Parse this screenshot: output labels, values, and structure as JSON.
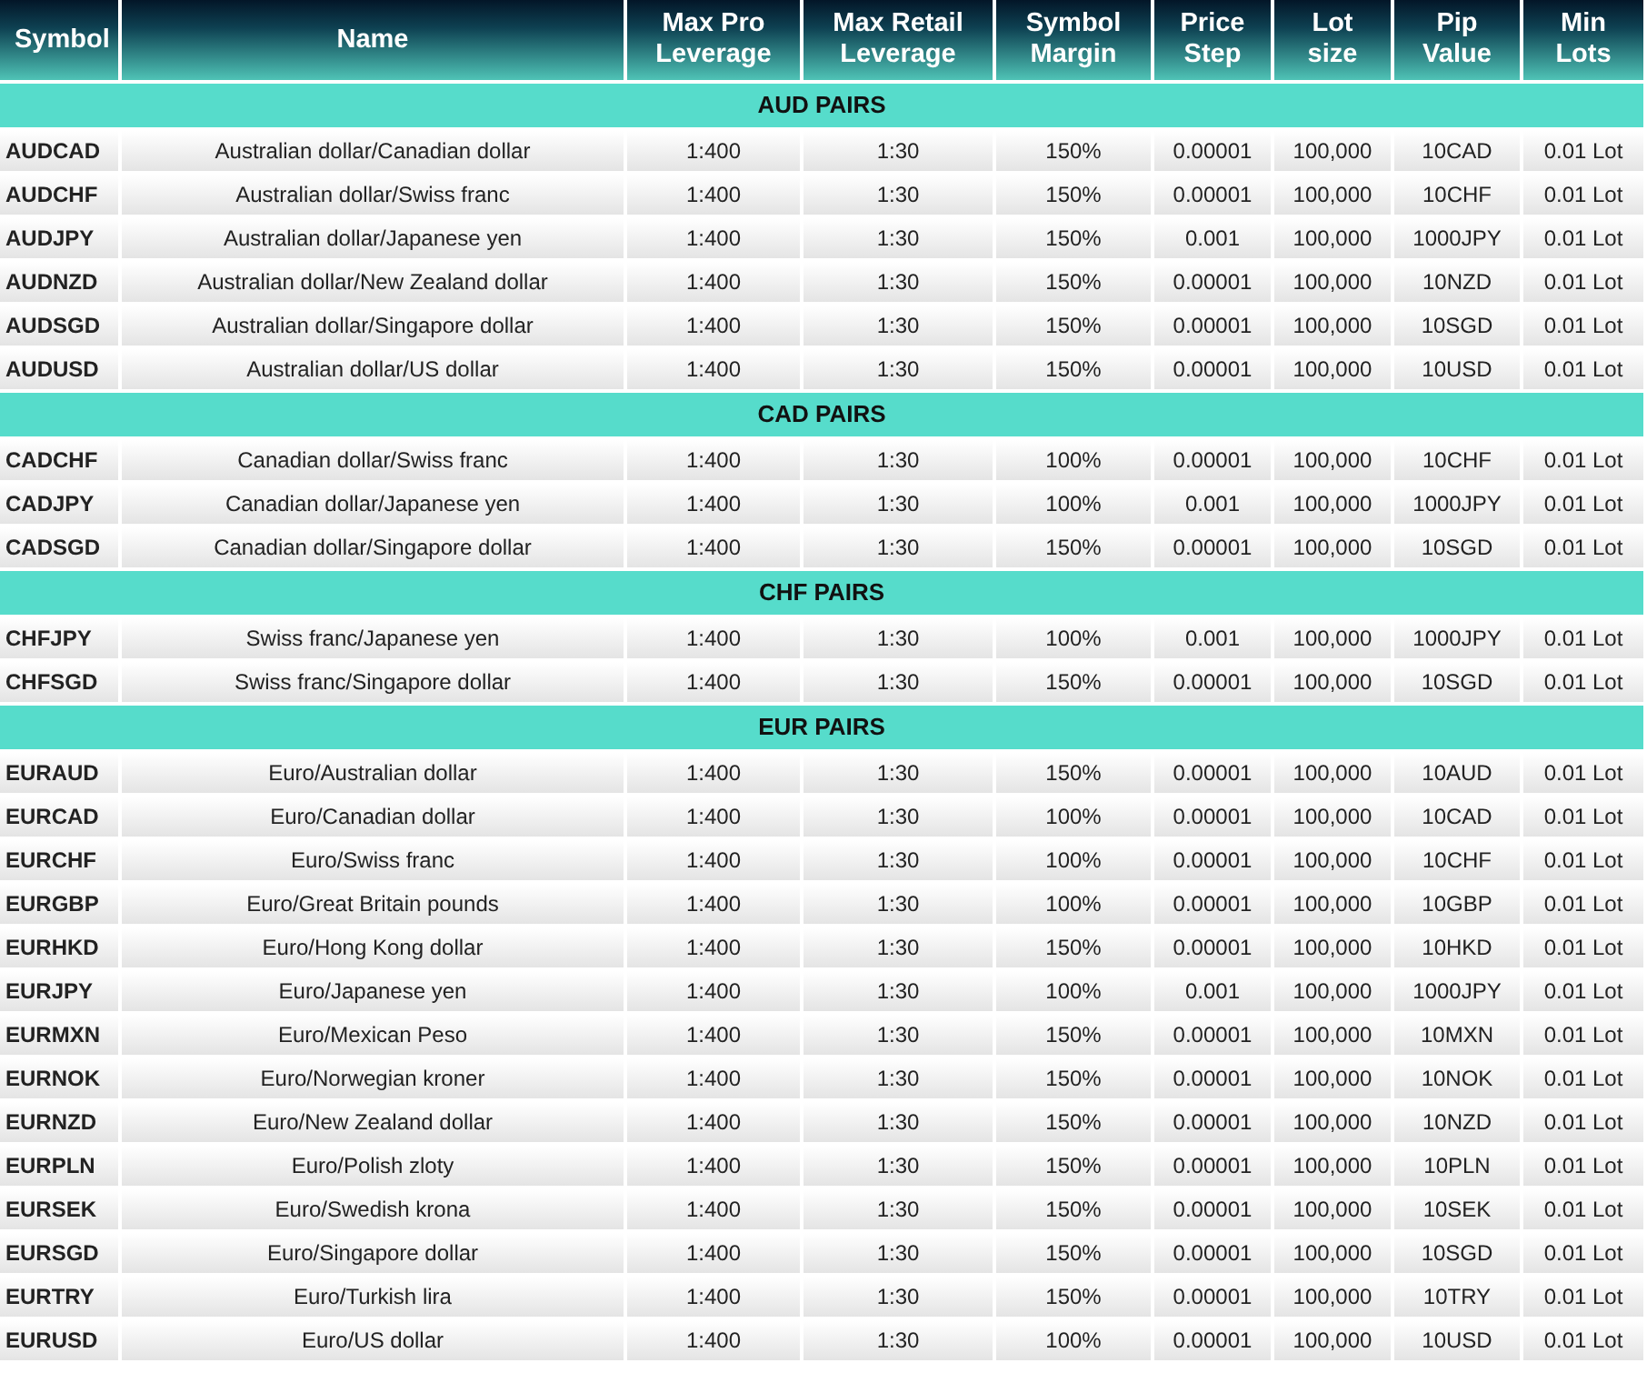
{
  "columns": [
    "Symbol",
    "Name",
    "Max Pro Leverage",
    "Max Retail Leverage",
    "Symbol Margin",
    "Price Step",
    "Lot size",
    "Pip Value",
    "Min Lots"
  ],
  "groups": [
    {
      "title": "AUD PAIRS",
      "rows": [
        [
          "AUDCAD",
          "Australian dollar/Canadian dollar",
          "1:400",
          "1:30",
          "150%",
          "0.00001",
          "100,000",
          "10CAD",
          "0.01 Lot"
        ],
        [
          "AUDCHF",
          "Australian dollar/Swiss franc",
          "1:400",
          "1:30",
          "150%",
          "0.00001",
          "100,000",
          "10CHF",
          "0.01 Lot"
        ],
        [
          "AUDJPY",
          "Australian dollar/Japanese yen",
          "1:400",
          "1:30",
          "150%",
          "0.001",
          "100,000",
          "1000JPY",
          "0.01 Lot"
        ],
        [
          "AUDNZD",
          "Australian dollar/New Zealand dollar",
          "1:400",
          "1:30",
          "150%",
          "0.00001",
          "100,000",
          "10NZD",
          "0.01 Lot"
        ],
        [
          "AUDSGD",
          "Australian dollar/Singapore dollar",
          "1:400",
          "1:30",
          "150%",
          "0.00001",
          "100,000",
          "10SGD",
          "0.01 Lot"
        ],
        [
          "AUDUSD",
          "Australian dollar/US dollar",
          "1:400",
          "1:30",
          "150%",
          "0.00001",
          "100,000",
          "10USD",
          "0.01 Lot"
        ]
      ]
    },
    {
      "title": "CAD PAIRS",
      "rows": [
        [
          "CADCHF",
          "Canadian dollar/Swiss franc",
          "1:400",
          "1:30",
          "100%",
          "0.00001",
          "100,000",
          "10CHF",
          "0.01 Lot"
        ],
        [
          "CADJPY",
          "Canadian dollar/Japanese yen",
          "1:400",
          "1:30",
          "100%",
          "0.001",
          "100,000",
          "1000JPY",
          "0.01 Lot"
        ],
        [
          "CADSGD",
          "Canadian dollar/Singapore dollar",
          "1:400",
          "1:30",
          "150%",
          "0.00001",
          "100,000",
          "10SGD",
          "0.01 Lot"
        ]
      ]
    },
    {
      "title": "CHF PAIRS",
      "rows": [
        [
          "CHFJPY",
          "Swiss franc/Japanese yen",
          "1:400",
          "1:30",
          "100%",
          "0.001",
          "100,000",
          "1000JPY",
          "0.01 Lot"
        ],
        [
          "CHFSGD",
          "Swiss franc/Singapore dollar",
          "1:400",
          "1:30",
          "150%",
          "0.00001",
          "100,000",
          "10SGD",
          "0.01 Lot"
        ]
      ]
    },
    {
      "title": "EUR PAIRS",
      "rows": [
        [
          "EURAUD",
          "Euro/Australian dollar",
          "1:400",
          "1:30",
          "150%",
          "0.00001",
          "100,000",
          "10AUD",
          "0.01 Lot"
        ],
        [
          "EURCAD",
          "Euro/Canadian dollar",
          "1:400",
          "1:30",
          "100%",
          "0.00001",
          "100,000",
          "10CAD",
          "0.01 Lot"
        ],
        [
          "EURCHF",
          "Euro/Swiss franc",
          "1:400",
          "1:30",
          "100%",
          "0.00001",
          "100,000",
          "10CHF",
          "0.01 Lot"
        ],
        [
          "EURGBP",
          "Euro/Great Britain pounds",
          "1:400",
          "1:30",
          "100%",
          "0.00001",
          "100,000",
          "10GBP",
          "0.01 Lot"
        ],
        [
          "EURHKD",
          "Euro/Hong Kong dollar",
          "1:400",
          "1:30",
          "150%",
          "0.00001",
          "100,000",
          "10HKD",
          "0.01 Lot"
        ],
        [
          "EURJPY",
          "Euro/Japanese yen",
          "1:400",
          "1:30",
          "100%",
          "0.001",
          "100,000",
          "1000JPY",
          "0.01 Lot"
        ],
        [
          "EURMXN",
          "Euro/Mexican Peso",
          "1:400",
          "1:30",
          "150%",
          "0.00001",
          "100,000",
          "10MXN",
          "0.01 Lot"
        ],
        [
          "EURNOK",
          "Euro/Norwegian kroner",
          "1:400",
          "1:30",
          "150%",
          "0.00001",
          "100,000",
          "10NOK",
          "0.01 Lot"
        ],
        [
          "EURNZD",
          "Euro/New Zealand dollar",
          "1:400",
          "1:30",
          "150%",
          "0.00001",
          "100,000",
          "10NZD",
          "0.01 Lot"
        ],
        [
          "EURPLN",
          "Euro/Polish zloty",
          "1:400",
          "1:30",
          "150%",
          "0.00001",
          "100,000",
          "10PLN",
          "0.01 Lot"
        ],
        [
          "EURSEK",
          "Euro/Swedish krona",
          "1:400",
          "1:30",
          "150%",
          "0.00001",
          "100,000",
          "10SEK",
          "0.01 Lot"
        ],
        [
          "EURSGD",
          "Euro/Singapore dollar",
          "1:400",
          "1:30",
          "150%",
          "0.00001",
          "100,000",
          "10SGD",
          "0.01 Lot"
        ],
        [
          "EURTRY",
          "Euro/Turkish lira",
          "1:400",
          "1:30",
          "150%",
          "0.00001",
          "100,000",
          "10TRY",
          "0.01 Lot"
        ],
        [
          "EURUSD",
          "Euro/US dollar",
          "1:400",
          "1:30",
          "100%",
          "0.00001",
          "100,000",
          "10USD",
          "0.01 Lot"
        ]
      ]
    }
  ]
}
